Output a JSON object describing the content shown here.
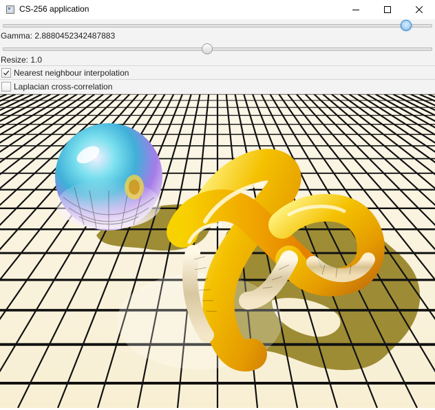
{
  "window": {
    "title": "CS-256 application",
    "buttons": [
      "minimize-icon",
      "maximize-icon",
      "close-icon"
    ]
  },
  "controls": {
    "slider_top": {
      "value_fraction": 0.95
    },
    "gamma_label": "Gamma: 2.8880452342487883",
    "slider_gamma": {
      "value_fraction": 0.475
    },
    "resize_label": "Resize: 1.0",
    "checkboxes": [
      {
        "label": "Nearest neighbour interpolation",
        "checked": true
      },
      {
        "label": "Laplacian cross-correlation",
        "checked": false
      }
    ]
  },
  "colors": {
    "accent_slider": "#3e88c4",
    "panel_bg": "#f3f3f3",
    "floor_tile": "#fbf3dd",
    "grid_line": "#111111",
    "shadow": "#7a6a10",
    "knot_yellow": "#f2b705",
    "sphere_tint": "#3fb8e0"
  },
  "render": {
    "description_icon": "ray-traced-scene"
  }
}
